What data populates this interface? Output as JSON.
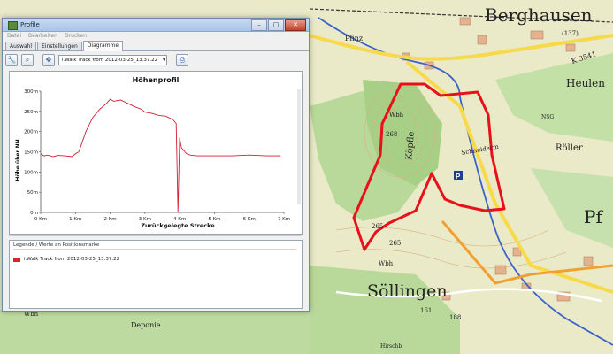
{
  "map": {
    "labels": {
      "berghausen": "Berghausen",
      "heulen": "Heulen",
      "roller": "Röller",
      "pf": "Pf",
      "soellingen": "Söllingen",
      "koepfle": "Köpfle",
      "wbh1": "Wbh",
      "wbh2": "Wbh",
      "wbh3": "Wbh",
      "elev_268": "268",
      "elev_265a": "265",
      "elev_265b": "265",
      "elev_188": "188",
      "elev_161": "161",
      "elev_137": "(137)",
      "pfinz": "Pfinz",
      "k3541": "K 3541",
      "nsg": "NSG",
      "deponie": "Deponie",
      "schneiderm": "Schneiderm",
      "hirsch": "Hirschb",
      "p_sign": "P"
    },
    "colors": {
      "track": "#e8101a",
      "forest": "#b9d99a",
      "meadow": "#eae9c8",
      "road_yellow": "#f7d94a",
      "road_orange": "#f0a030",
      "water": "#3a62c8"
    }
  },
  "window": {
    "title": "Profile",
    "menu": [
      "Datei",
      "Bearbeiten",
      "Drucken"
    ],
    "tabs": [
      "Auswahl",
      "Einstellungen",
      "Diagramme"
    ],
    "active_tab": "Diagramme",
    "toolbar": {
      "icons": [
        "wrench-icon",
        "zoom-icon",
        "move-icon",
        "print-icon"
      ],
      "track_selected": "i.Walk Track from 2012-03-25_13.37.22"
    },
    "legend": {
      "title": "Legende / Werte an Positionsmarke",
      "item": "i.Walk Track from 2012-03-25_13.37.22",
      "item_color": "#e0202c"
    }
  },
  "chart_data": {
    "type": "line",
    "title": "Höhenprofil",
    "xlabel": "Zurückgelegte Strecke",
    "ylabel": "Höhe über NN",
    "xlim": [
      0,
      7
    ],
    "ylim": [
      0,
      300
    ],
    "x_ticks": [
      "0 Km",
      "1 Km",
      "2 Km",
      "3 Km",
      "4 Km",
      "5 Km",
      "6 Km",
      "7 Km"
    ],
    "y_ticks": [
      "0m",
      "50m",
      "100m",
      "150m",
      "200m",
      "250m",
      "300m"
    ],
    "series_color": "#d02030",
    "x": [
      0,
      0.1,
      0.2,
      0.35,
      0.5,
      0.7,
      0.9,
      1.0,
      1.1,
      1.3,
      1.5,
      1.7,
      1.9,
      2.0,
      2.1,
      2.3,
      2.5,
      2.7,
      2.9,
      3.0,
      3.2,
      3.4,
      3.6,
      3.8,
      3.9,
      3.95,
      4.0,
      4.05,
      4.1,
      4.15,
      4.2,
      4.3,
      4.5,
      5.0,
      5.5,
      6.0,
      6.5,
      6.9
    ],
    "y": [
      145,
      140,
      142,
      138,
      141,
      140,
      138,
      145,
      150,
      200,
      235,
      255,
      270,
      280,
      275,
      278,
      270,
      262,
      255,
      248,
      245,
      240,
      238,
      230,
      220,
      0,
      185,
      160,
      155,
      150,
      145,
      142,
      140,
      140,
      140,
      142,
      140,
      140
    ]
  }
}
